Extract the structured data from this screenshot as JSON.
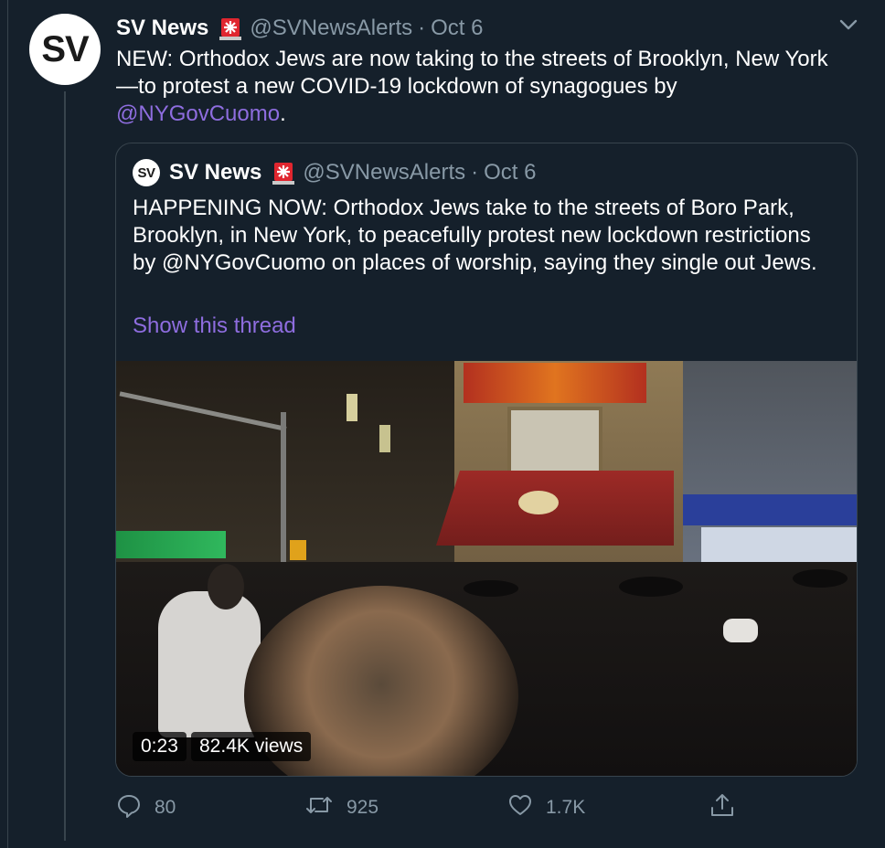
{
  "tweet": {
    "display_name": "SV News",
    "handle": "@SVNewsAlerts",
    "separator": "·",
    "date": "Oct 6",
    "avatar_text": "SV",
    "text_prefix": "NEW: Orthodox Jews are now taking to the streets of Brooklyn, New York—to protest a new COVID-19 lockdown of synagogues by ",
    "mention": "@NYGovCuomo",
    "text_suffix": "."
  },
  "quoted_tweet": {
    "display_name": "SV News",
    "handle": "@SVNewsAlerts",
    "separator": "·",
    "date": "Oct 6",
    "avatar_text": "SV",
    "text": "HAPPENING NOW: Orthodox Jews take to the streets of Boro Park, Brooklyn, in New York, to peacefully protest new lockdown restrictions by @NYGovCuomo on places of worship, saying they single out Jews.",
    "show_thread": "Show this thread",
    "video": {
      "duration": "0:23",
      "views": "82.4K views"
    }
  },
  "actions": {
    "replies": "80",
    "retweets": "925",
    "likes": "1.7K"
  },
  "icons": {
    "name_badge": "siren-icon",
    "menu": "chevron-down-icon",
    "reply": "reply-icon",
    "retweet": "retweet-icon",
    "like": "heart-icon",
    "share": "share-icon"
  },
  "colors": {
    "background": "#15202b",
    "link": "#8e6ddf",
    "muted": "#8899a6",
    "border": "#38444d"
  }
}
